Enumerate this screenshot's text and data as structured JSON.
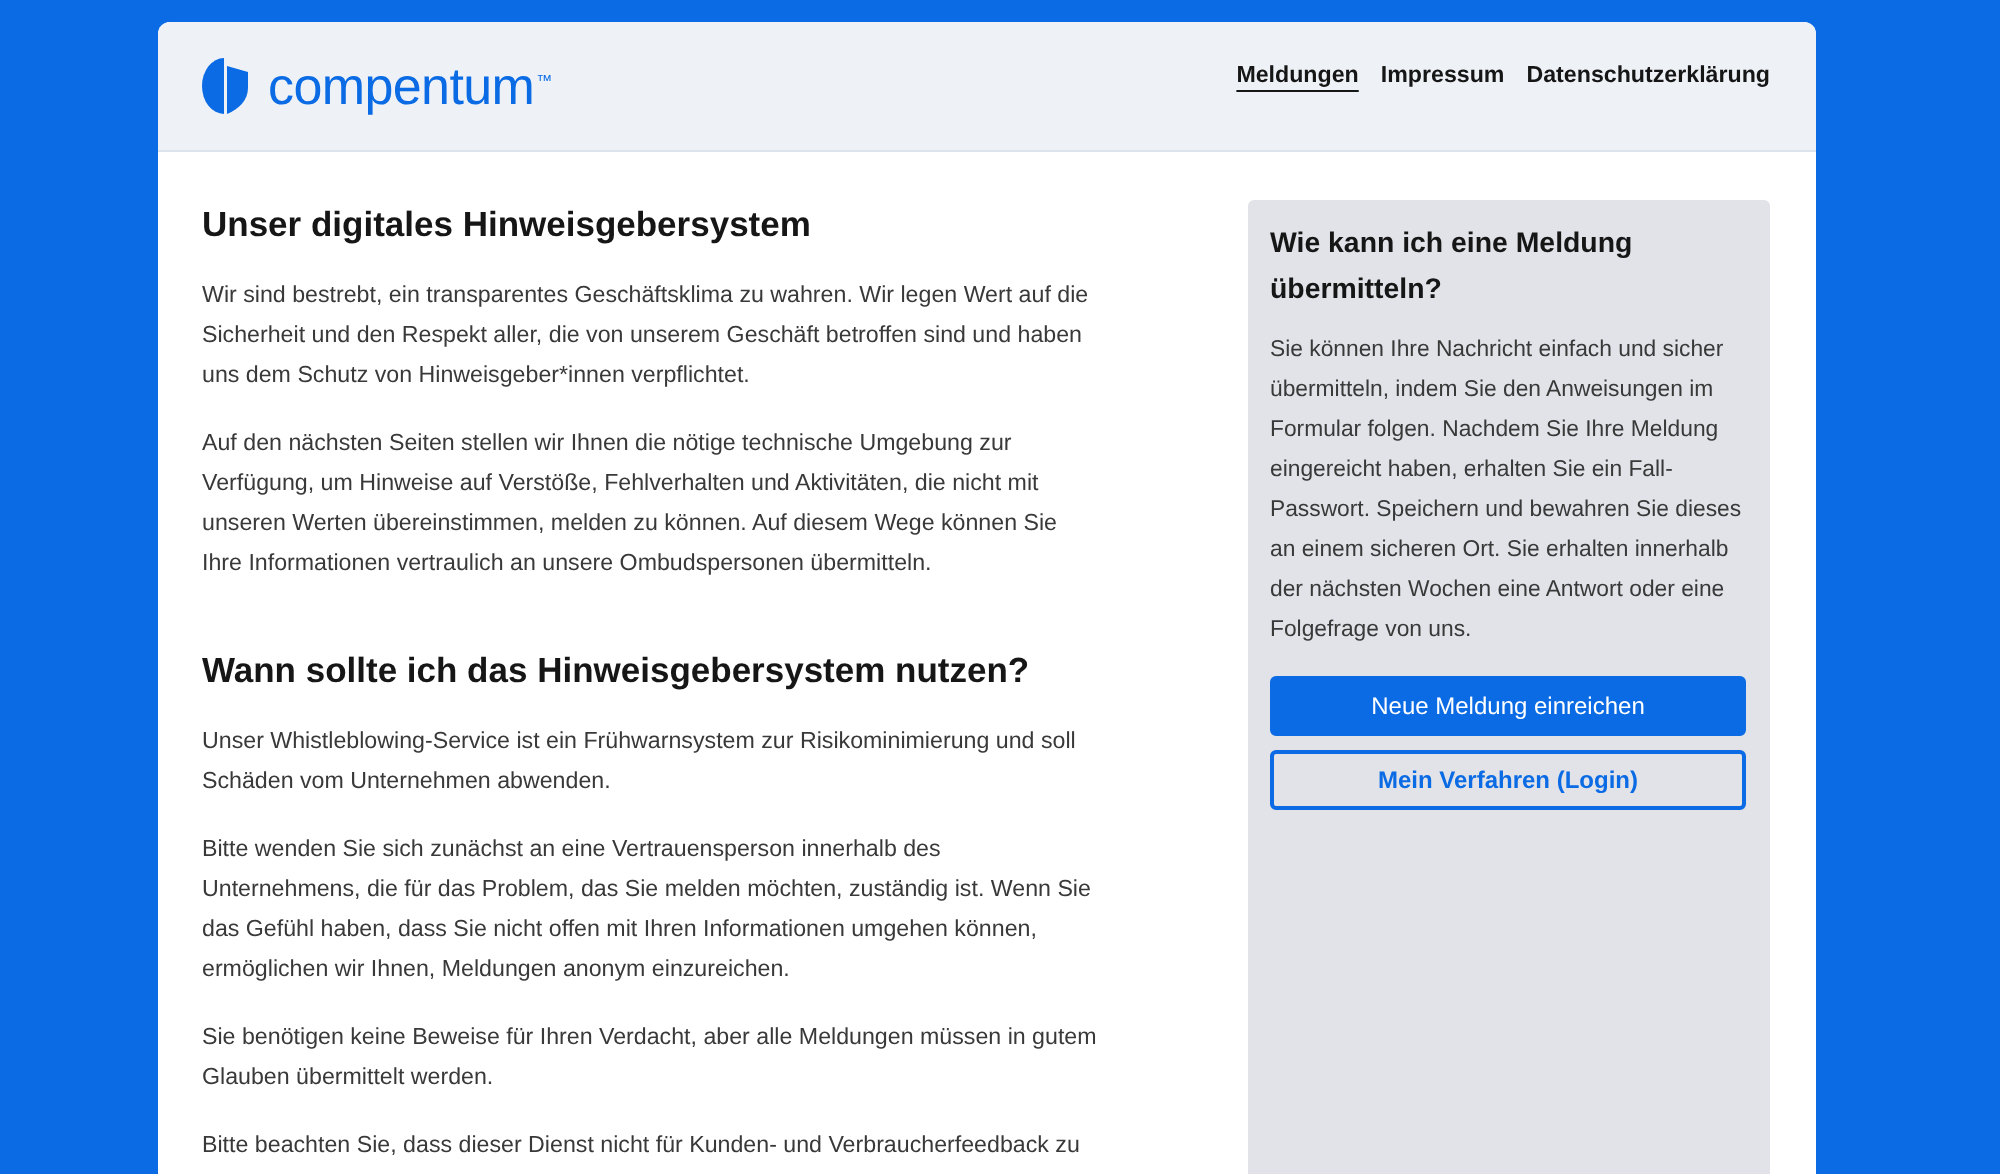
{
  "header": {
    "logo": {
      "text": "compentum$^{™}$"
    },
    "nav": [
      {
        "label": "Meldungen",
        "selected": true
      },
      {
        "label": "Impressum",
        "selected": false
      },
      {
        "label": "Datenschutzerklärung",
        "selected": false
      }
    ]
  },
  "main": {
    "sections": [
      {
        "heading": "Unser digitales Hinweisgebersystem",
        "paragraphs": [
          "Wir sind bestrebt, ein transparentes Geschäftsklima zu wahren. Wir legen Wert auf die Sicherheit und den Respekt aller, die von unserem Geschäft betroffen sind und haben uns dem Schutz von Hinweisgeber*innen verpflichtet.",
          "Auf den nächsten Seiten stellen wir Ihnen die nötige technische Umgebung zur Verfügung, um Hinweise auf Verstöße, Fehlverhalten und Aktivitäten, die nicht mit unseren Werten übereinstimmen, melden zu können. Auf diesem Wege können Sie Ihre Informationen vertraulich an unsere Ombudspersonen übermitteln."
        ]
      },
      {
        "heading": "Wann sollte ich das Hinweisgebersystem nutzen?",
        "paragraphs": [
          "Unser Whistleblowing-Service ist ein Frühwarnsystem zur Risikominimierung und soll Schäden vom Unternehmen abwenden.",
          "Bitte wenden Sie sich zunächst an eine Vertrauensperson innerhalb des Unternehmens, die für das Problem, das Sie melden möchten, zuständig ist. Wenn Sie das Gefühl haben, dass Sie nicht offen mit Ihren Informationen umgehen können, ermöglichen wir Ihnen, Meldungen anonym einzureichen.",
          "Sie benötigen keine Beweise für Ihren Verdacht, aber alle Meldungen müssen in gutem Glauben übermittelt werden.",
          "Bitte beachten Sie, dass dieser Dienst nicht für Kunden- und Verbraucherfeedback zu"
        ]
      }
    ]
  },
  "sidebar": {
    "heading": "Wie kann ich eine Meldung übermitteln?",
    "text": "Sie können Ihre Nachricht einfach und sicher übermitteln, indem Sie den Anweisungen im Formular folgen. Nachdem Sie Ihre Meldung eingereicht haben, erhalten Sie ein Fall-Passwort. Speichern und bewahren Sie dieses an einem sicheren Ort. Sie erhalten innerhalb der nächsten Wochen eine Antwort oder eine Folgefrage von uns.",
    "buttons": [
      {
        "label": "Neue Meldung einreichen",
        "kind": "primary"
      },
      {
        "label": "Mein Verfahren (Login)",
        "kind": "outline"
      }
    ]
  }
}
